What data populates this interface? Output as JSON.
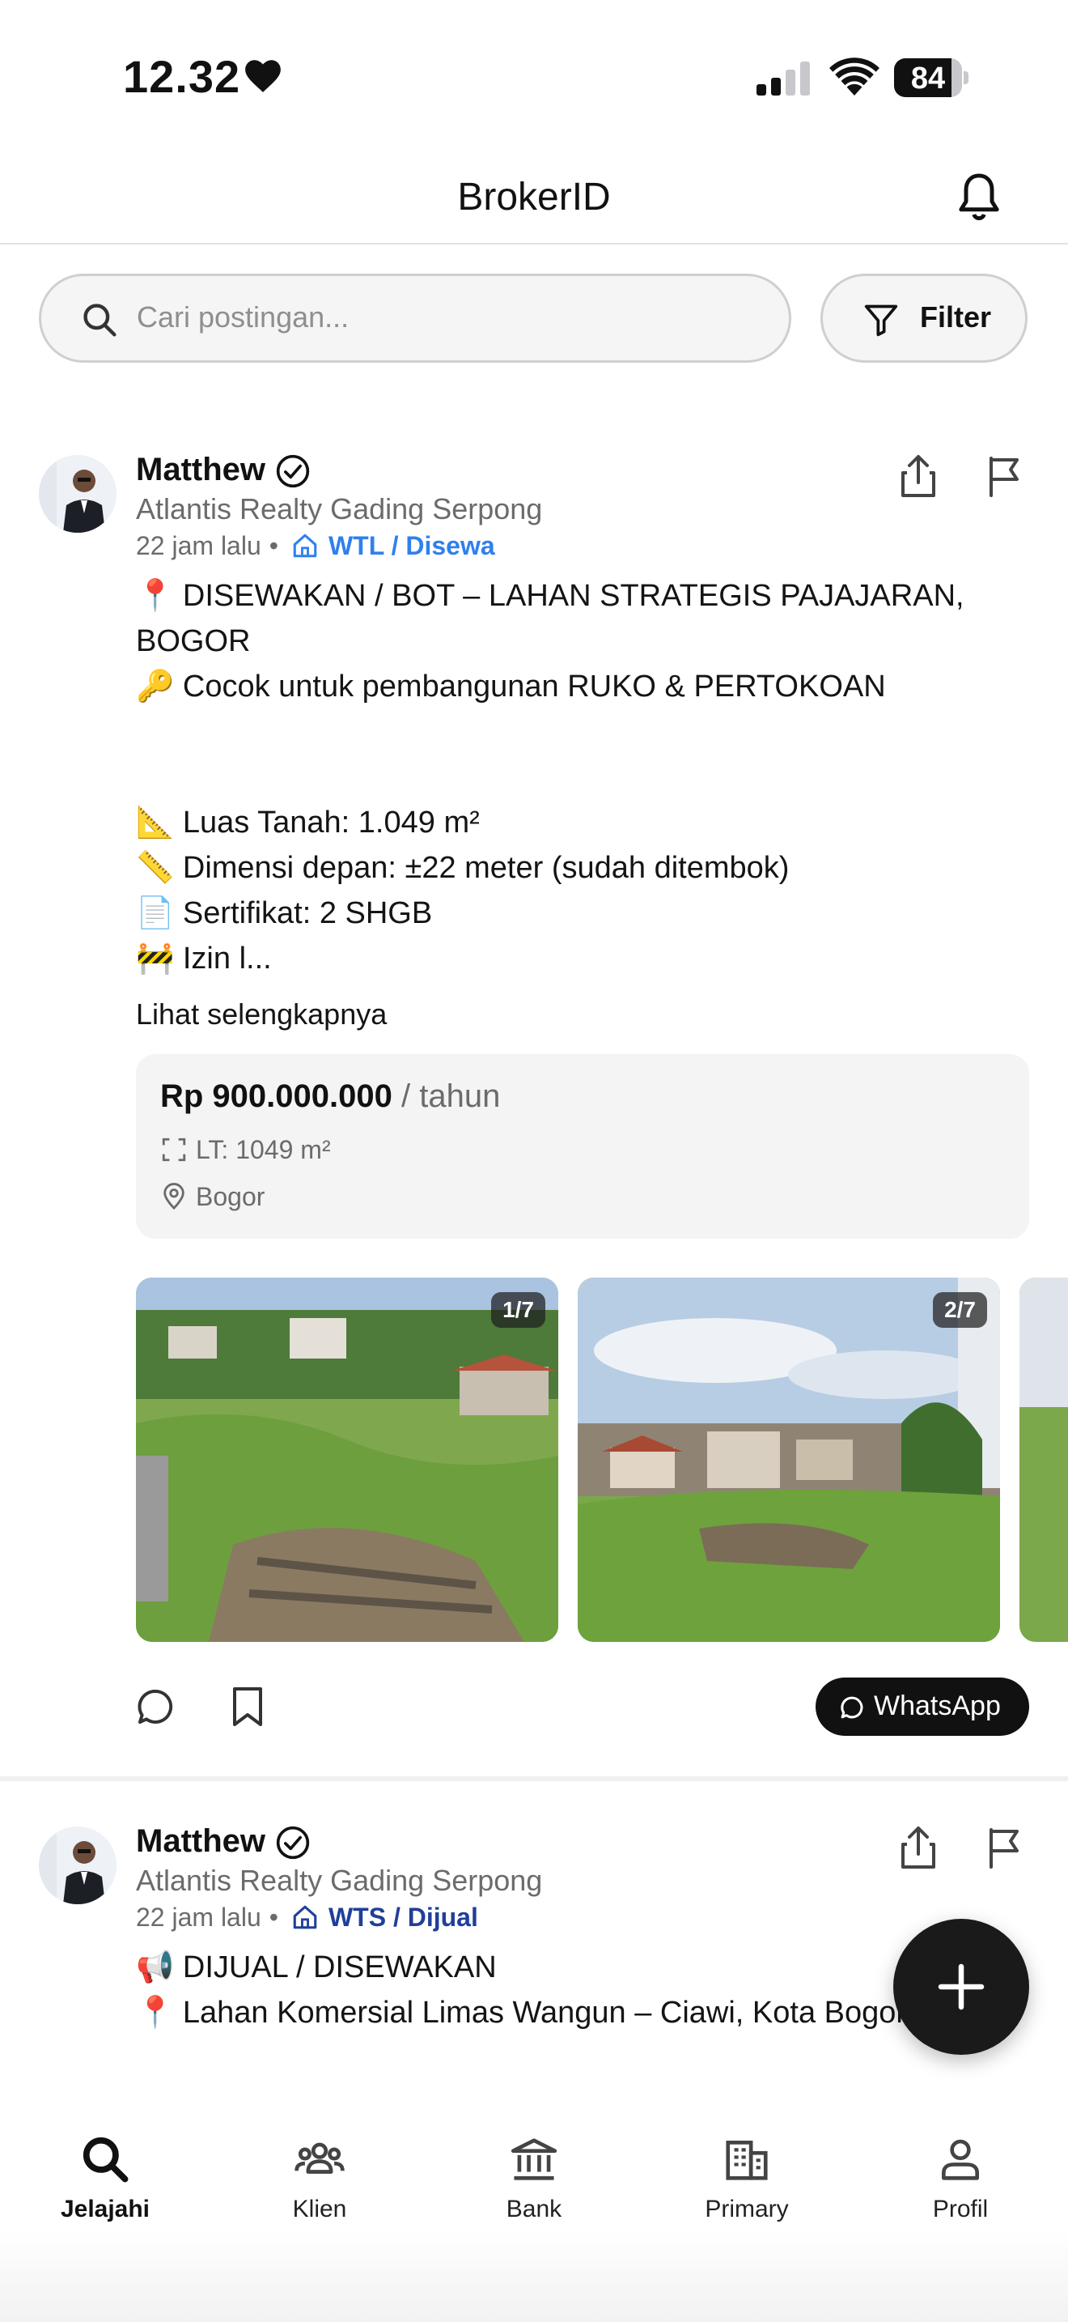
{
  "status_bar": {
    "time": "12.32",
    "battery": "84",
    "battery_level": 0.84
  },
  "header": {
    "title": "BrokerID"
  },
  "search": {
    "placeholder": "Cari postingan...",
    "filter_label": "Filter"
  },
  "posts": [
    {
      "author": "Matthew",
      "verified": true,
      "agency": "Atlantis Realty Gading Serpong",
      "time": "22 jam lalu",
      "tag": "WTL / Disewa",
      "tag_color": "#2f80ed",
      "body": "📍 DISEWAKAN / BOT – LAHAN STRATEGIS PAJAJARAN, BOGOR\n🔑 Cocok untuk pembangunan RUKO & PERTOKOAN\n\n\n📐 Luas Tanah: 1.049 m²\n📏 Dimensi depan: ±22 meter (sudah ditembok)\n📄 Sertifikat: 2 SHGB\n🚧 Izin l...",
      "see_more": "Lihat selengkapnya",
      "price": "Rp 900.000.000",
      "price_period": "/ tahun",
      "land_area": "LT: 1049 m²",
      "location": "Bogor",
      "photos": [
        {
          "counter": "1/7"
        },
        {
          "counter": "2/7"
        }
      ],
      "whatsapp_label": "WhatsApp"
    },
    {
      "author": "Matthew",
      "verified": true,
      "agency": "Atlantis Realty Gading Serpong",
      "time": "22 jam lalu",
      "tag": "WTS / Dijual",
      "tag_color": "#1f3f9a",
      "body": "📢 DIJUAL / DISEWAKAN\n📍 Lahan Komersial Limas Wangun – Ciawi, Kota Bogor"
    }
  ],
  "bottom_nav": {
    "items": [
      {
        "label": "Jelajahi",
        "icon": "search-icon",
        "active": true
      },
      {
        "label": "Klien",
        "icon": "people-icon",
        "active": false
      },
      {
        "label": "Bank",
        "icon": "bank-icon",
        "active": false
      },
      {
        "label": "Primary",
        "icon": "building-icon",
        "active": false
      },
      {
        "label": "Profil",
        "icon": "person-icon",
        "active": false
      }
    ]
  },
  "fab": {
    "icon": "plus-icon"
  }
}
